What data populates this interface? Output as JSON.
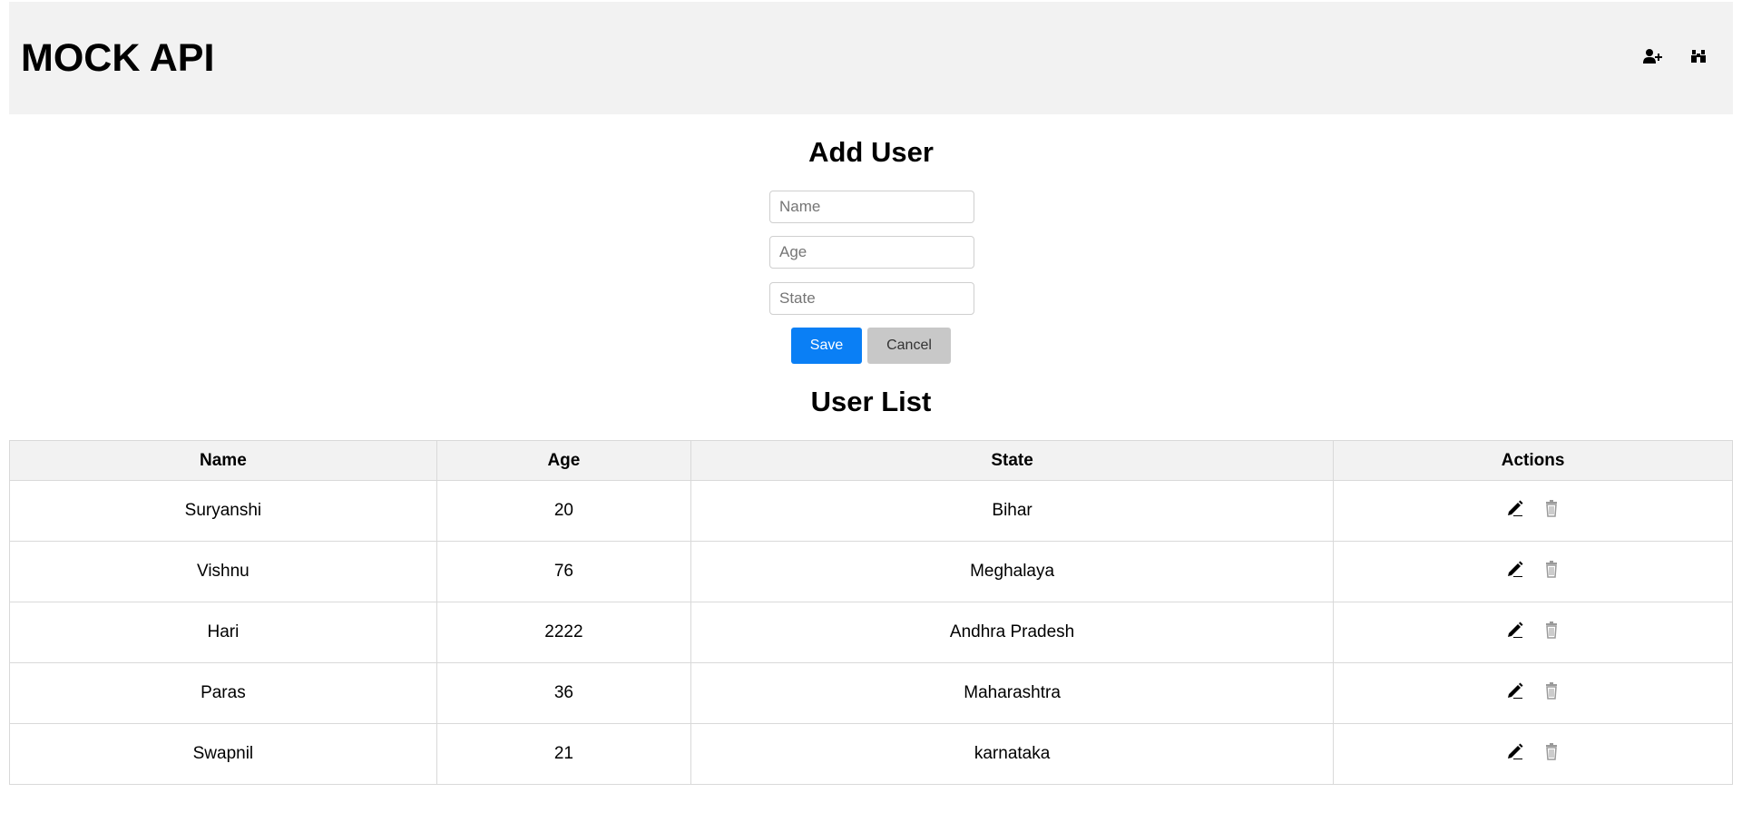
{
  "header": {
    "title": "MOCK API",
    "icons": [
      "add-user-icon",
      "binoculars-icon"
    ]
  },
  "add_user": {
    "title": "Add User",
    "name_placeholder": "Name",
    "age_placeholder": "Age",
    "state_placeholder": "State",
    "save_label": "Save",
    "cancel_label": "Cancel"
  },
  "user_list": {
    "title": "User List",
    "columns": [
      "Name",
      "Age",
      "State",
      "Actions"
    ],
    "rows": [
      {
        "name": "Suryanshi",
        "age": "20",
        "state": "Bihar"
      },
      {
        "name": "Vishnu",
        "age": "76",
        "state": "Meghalaya"
      },
      {
        "name": "Hari",
        "age": "2222",
        "state": "Andhra Pradesh"
      },
      {
        "name": "Paras",
        "age": "36",
        "state": "Maharashtra"
      },
      {
        "name": "Swapnil",
        "age": "21",
        "state": "karnataka"
      }
    ],
    "row_icons": [
      "pencil-icon",
      "trash-icon"
    ]
  },
  "colors": {
    "header_bg": "#f2f2f2",
    "save_button": "#0a7ff5",
    "cancel_button": "#c8c8c8",
    "table_header_bg": "#f2f2f2"
  }
}
